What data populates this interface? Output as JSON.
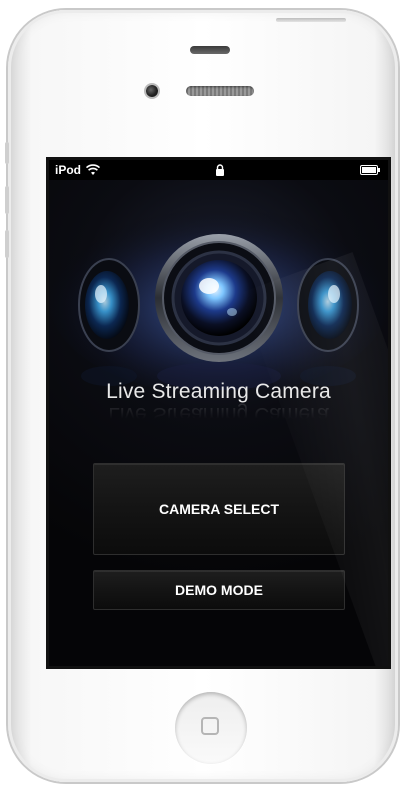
{
  "status_bar": {
    "carrier": "iPod"
  },
  "app": {
    "title": "Live Streaming Camera"
  },
  "buttons": {
    "camera_select": "CAMERA SELECT",
    "demo_mode": "DEMO MODE"
  },
  "icons": {
    "wifi": "wifi-icon",
    "lock": "lock-icon",
    "battery": "battery-icon",
    "hero": "camera-lens-icon",
    "home": "home-button"
  },
  "colors": {
    "screen_background": "#000000",
    "button_text": "#ffffff",
    "title_text": "#e8e8e8",
    "lens_glow": "#5a8cff"
  }
}
